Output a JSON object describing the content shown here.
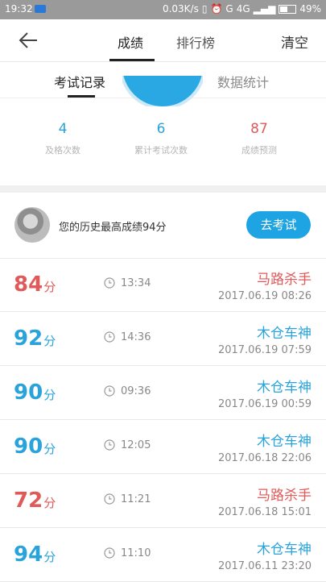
{
  "status": {
    "time": "19:32",
    "speed": "0.03K/s",
    "signal": "G",
    "network": "4G",
    "battery": "49%",
    "battery_level": 0.49
  },
  "header": {
    "tabs": [
      "成绩",
      "排行榜"
    ],
    "clear": "清空"
  },
  "subtabs": [
    "考试记录",
    "数据统计"
  ],
  "stats": [
    {
      "value": "4",
      "label": "及格次数"
    },
    {
      "value": "6",
      "label": "累计考试次数"
    },
    {
      "value": "87",
      "label": "成绩预测"
    }
  ],
  "best": {
    "text": "您的历史最高成绩94分",
    "button": "去考试"
  },
  "unit": "分",
  "records": [
    {
      "score": "84",
      "duration": "13:34",
      "title": "马路杀手",
      "date": "2017.06.19",
      "time": "08:26"
    },
    {
      "score": "92",
      "duration": "14:36",
      "title": "木仓车神",
      "date": "2017.06.19",
      "time": "07:59"
    },
    {
      "score": "90",
      "duration": "09:36",
      "title": "木仓车神",
      "date": "2017.06.19",
      "time": "00:59"
    },
    {
      "score": "90",
      "duration": "12:05",
      "title": "木仓车神",
      "date": "2017.06.18",
      "time": "22:06"
    },
    {
      "score": "72",
      "duration": "11:21",
      "title": "马路杀手",
      "date": "2017.06.18",
      "time": "15:01"
    },
    {
      "score": "94",
      "duration": "11:10",
      "title": "木仓车神",
      "date": "2017.06.11",
      "time": "23:20"
    }
  ],
  "colors": {
    "fail": "#e05a5a",
    "pass": "#29a3dc",
    "accent": "#1ea4e2"
  }
}
